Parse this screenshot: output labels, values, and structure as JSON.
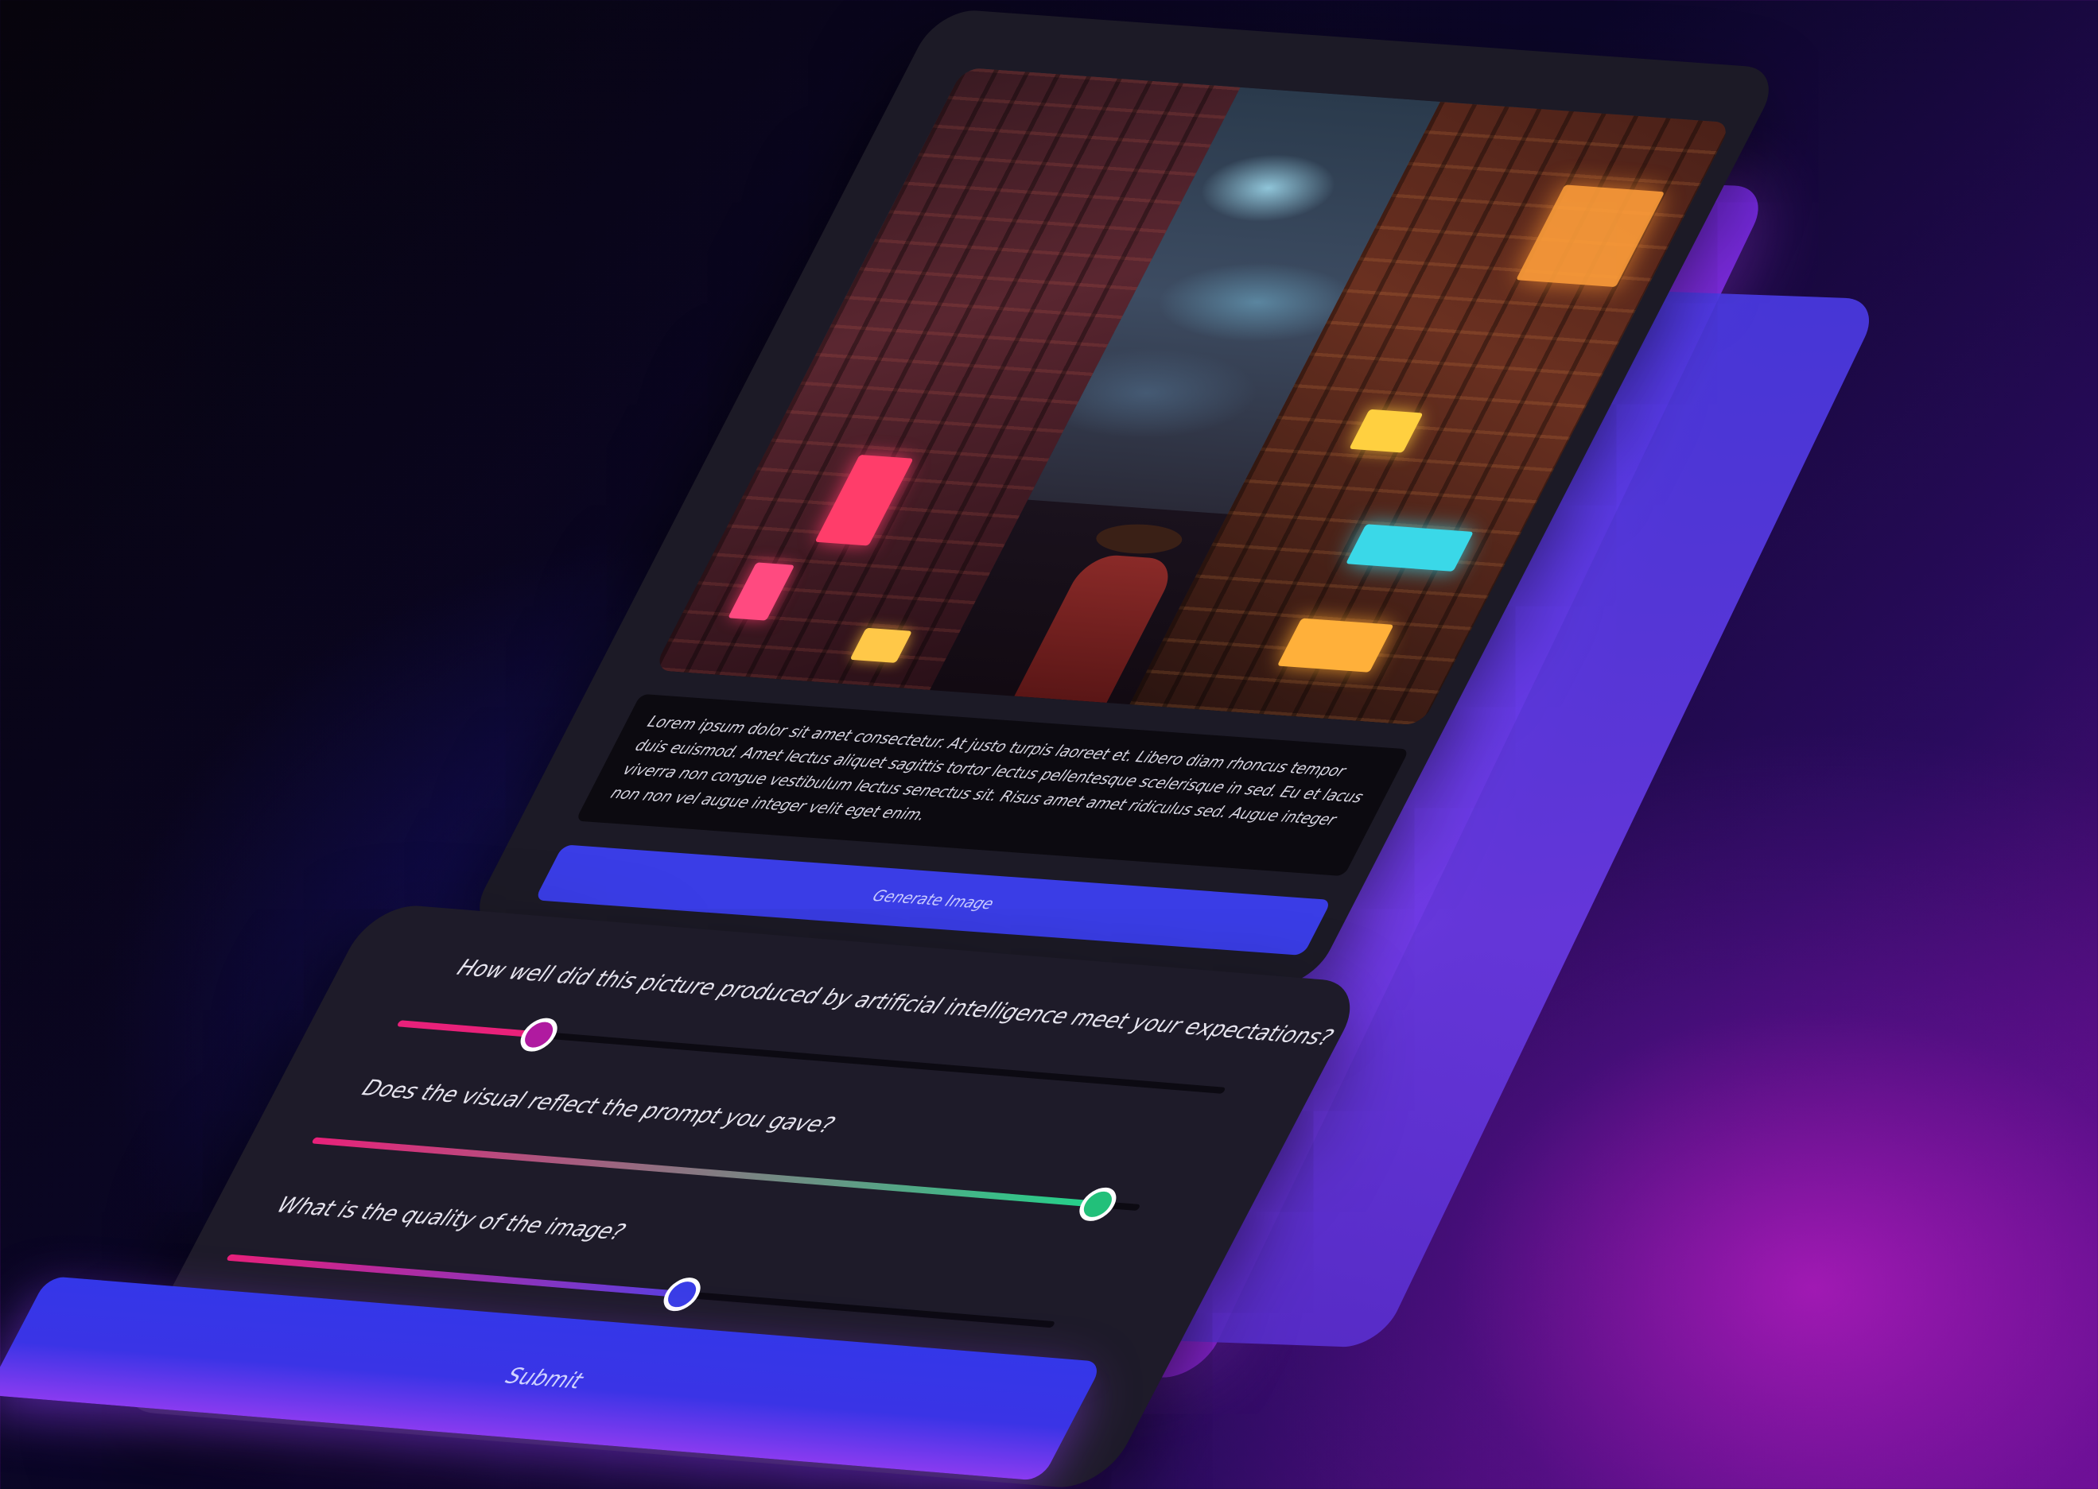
{
  "image_card": {
    "description": "Lorem ipsum dolor sit amet consectetur. At justo turpis laoreet et. Libero diam rhoncus tempor duis euismod. Amet lectus aliquet sagittis tortor lectus pellentesque scelerisque in sed. Eu et lacus viverra non congue vestibulum lectus senectus sit. Risus amet amet ridiculus sed. Augue integer non non vel augue integer velit eget enim.",
    "generate_label": "Generate Image",
    "image_alt_icon": "cyberpunk-street-image"
  },
  "rating_card": {
    "questions": [
      {
        "label": "How well did this picture produced by artificial intelligence meet your expectations?",
        "value": 0.17,
        "fill_colors": [
          "#e8217a",
          "#e8217a"
        ],
        "thumb_color": "#b01aa0"
      },
      {
        "label": "Does the visual reflect the prompt you gave?",
        "value": 0.95,
        "fill_colors": [
          "#e8217a",
          "#22d38a"
        ],
        "thumb_color": "#22c07a"
      },
      {
        "label": "What is the quality of the image?",
        "value": 0.55,
        "fill_colors": [
          "#e8217a",
          "#5a3fe0"
        ],
        "thumb_color": "#3a3de6"
      }
    ],
    "submit_label": "Submit"
  },
  "colors": {
    "accent_blue": "#3a3de6",
    "card_bg": "#1e1b29",
    "glow_purple": "#b43be8",
    "track_bg": "#0c0a12"
  }
}
